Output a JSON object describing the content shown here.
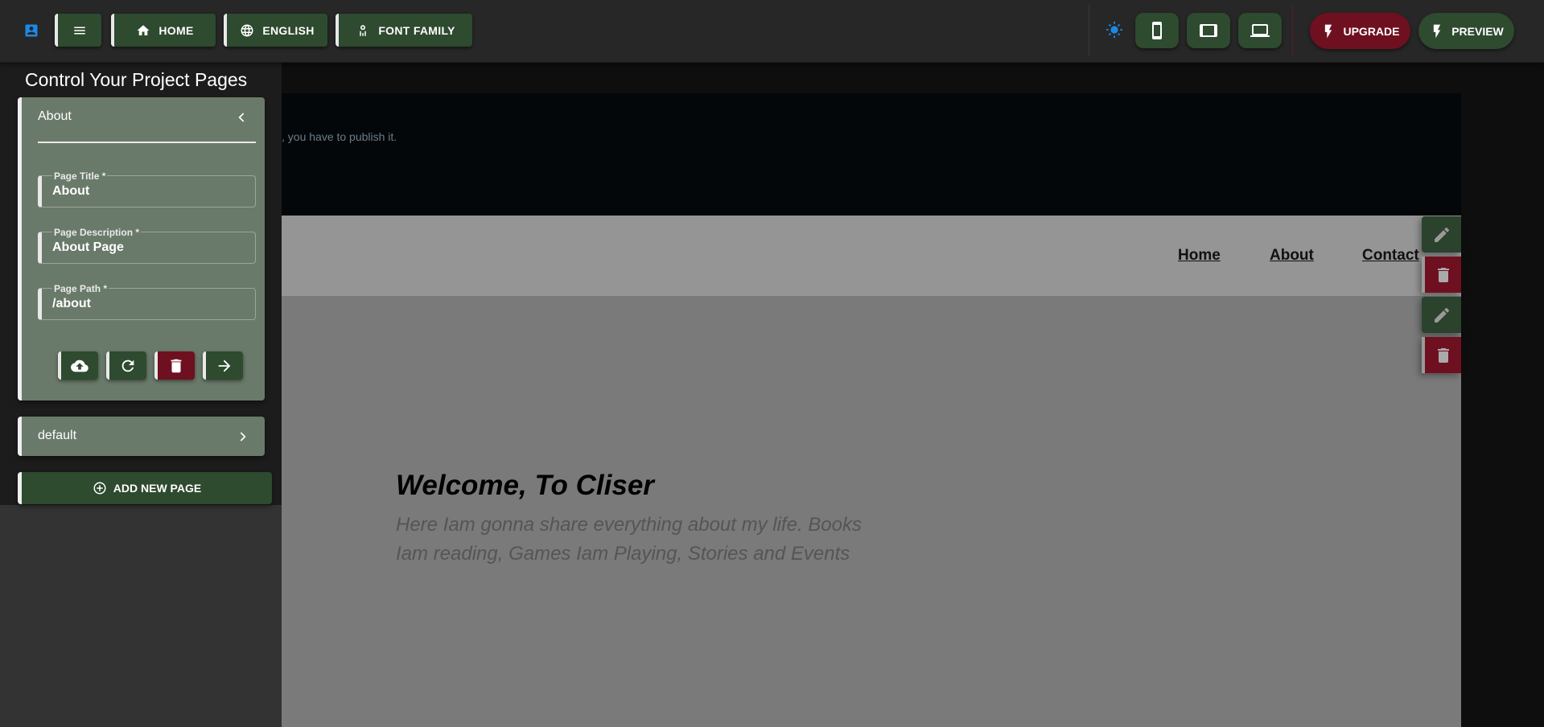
{
  "toolbar": {
    "home_label": "HOME",
    "language_label": "ENGLISH",
    "font_label": "FONT FAMILY",
    "upgrade_label": "UPGRADE",
    "preview_label": "PREVIEW"
  },
  "panel": {
    "title": "Control Your Project Pages",
    "pages": [
      {
        "name": "About",
        "expanded": true,
        "fields": [
          {
            "label": "Page Title *",
            "value": "About"
          },
          {
            "label": "Page Description *",
            "value": "About Page"
          },
          {
            "label": "Page Path *",
            "value": "/about"
          }
        ]
      },
      {
        "name": "default",
        "expanded": false
      }
    ],
    "add_page_label": "ADD NEW PAGE"
  },
  "preview": {
    "banner_text": ", you have to publish it.",
    "nav": [
      "Home",
      "About",
      "Contact"
    ],
    "hero_title": "Welcome, To Cliser",
    "hero_subtitle_line1": "Here Iam gonna share everything about my life. Books",
    "hero_subtitle_line2": "Iam reading, Games Iam Playing, Stories and Events"
  },
  "colors": {
    "accent_green": "#2e4a2f",
    "accent_red": "#6e1020",
    "panel_card": "#6a7a6a",
    "topbar": "#272727",
    "theme_icon": "#1e88e5"
  },
  "icons": {
    "logo": "account-box-icon",
    "menu": "hamburger-menu-icon",
    "home": "home-icon",
    "language": "globe-icon",
    "font": "font-family-icon",
    "theme": "sun-icon",
    "mobile": "mobile-device-icon",
    "tablet": "tablet-device-icon",
    "desktop": "laptop-device-icon",
    "upgrade": "lightning-icon",
    "preview": "lightning-icon"
  }
}
